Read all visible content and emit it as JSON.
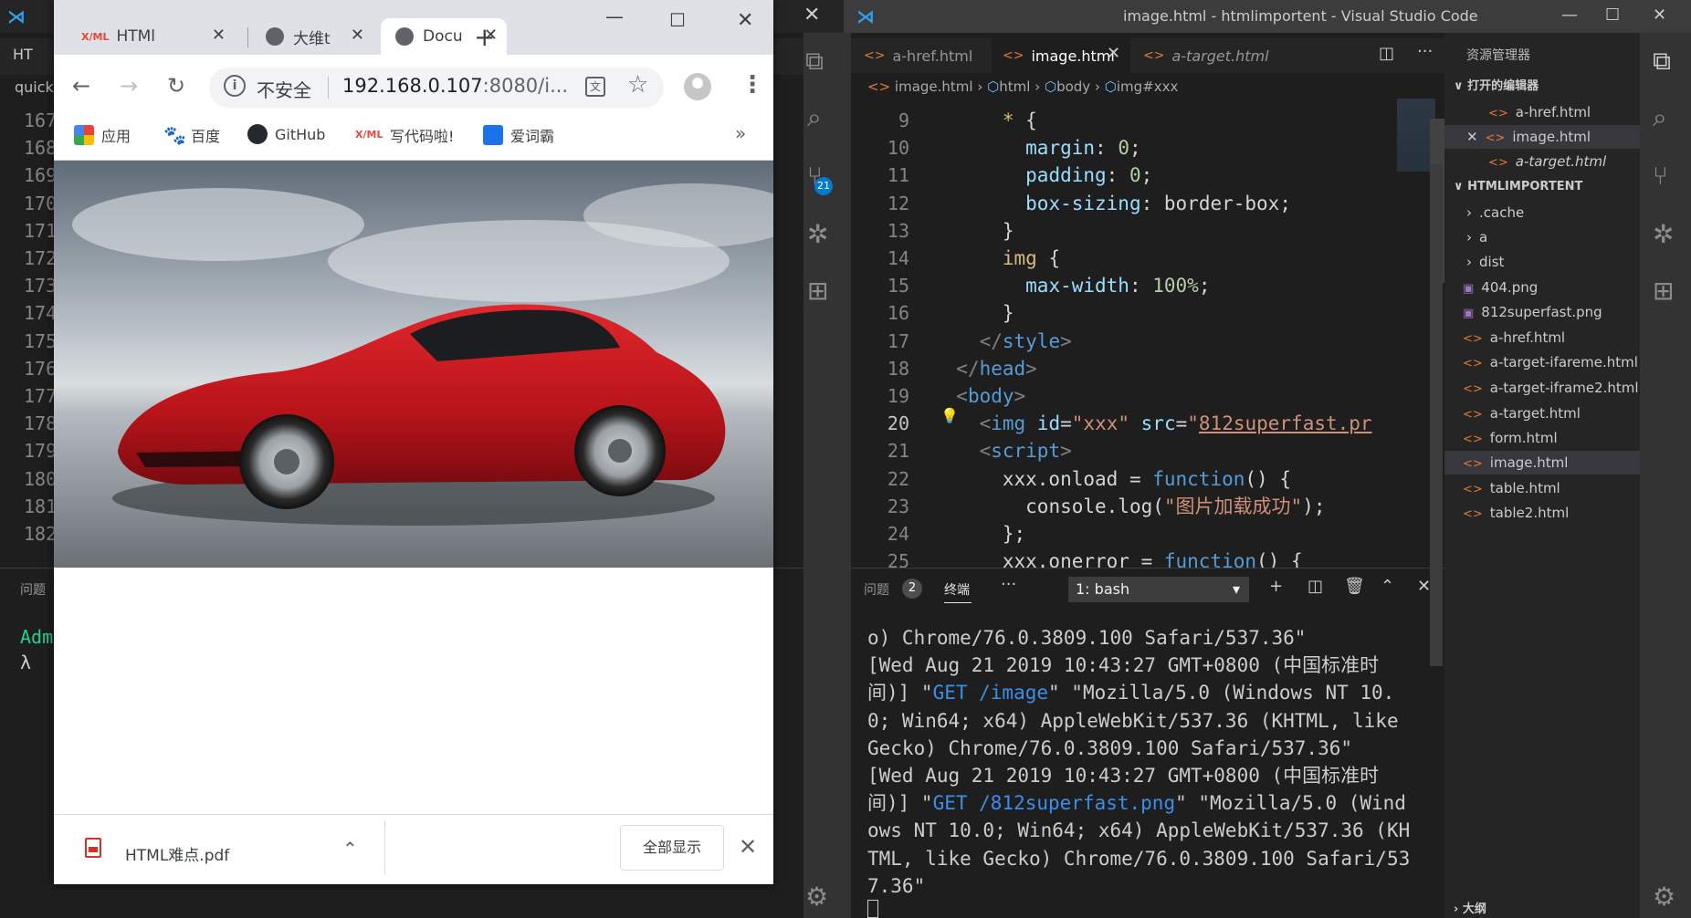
{
  "left_window": {
    "tab_label": "HT",
    "breadcrumb": "quicks",
    "line_numbers": [
      "167",
      "168",
      "169",
      "170",
      "171",
      "172",
      "173",
      "174",
      "175",
      "176",
      "177",
      "178",
      "179",
      "180",
      "181",
      "182"
    ],
    "panel_tab": "问题",
    "terminal_prompt": "Adm",
    "terminal_lambda": "λ"
  },
  "chrome": {
    "tabs": [
      {
        "title": "HTMl",
        "icon": "xml-icon"
      },
      {
        "title": "大维t",
        "icon": "globe-icon"
      },
      {
        "title": "Docu",
        "icon": "globe-icon",
        "active": true
      }
    ],
    "omnibox": {
      "security_text": "不安全",
      "host": "192.168.0.107",
      "port_path": ":8080/i..."
    },
    "bookmarks": [
      {
        "label": "应用",
        "icon": "apps-grid-icon"
      },
      {
        "label": "百度",
        "icon": "baidu-paw-icon"
      },
      {
        "label": "GitHub",
        "icon": "github-icon"
      },
      {
        "label": "写代码啦!",
        "icon": "xml-icon"
      },
      {
        "label": "爱词霸",
        "icon": "iciba-icon"
      }
    ],
    "bookmarks_more": "»",
    "download": {
      "filename": "HTML难点.pdf",
      "show_all": "全部显示"
    }
  },
  "vscode": {
    "window_title": "image.html - htmlimportent - Visual Studio Code",
    "tabs": [
      {
        "label": "a-href.html"
      },
      {
        "label": "image.html",
        "active": true
      },
      {
        "label": "a-target.html",
        "italic": true
      }
    ],
    "breadcrumb": [
      "image.html",
      "html",
      "body",
      "img#xxx"
    ],
    "line_numbers": [
      "9",
      "10",
      "11",
      "12",
      "13",
      "14",
      "15",
      "16",
      "17",
      "18",
      "19",
      "20",
      "21",
      "22",
      "23",
      "24",
      "25"
    ],
    "current_line": "20",
    "scm_badge": "21",
    "terminal": {
      "tab_problems": "问题",
      "problems_count": "2",
      "tab_terminal": "终端",
      "more": "···",
      "selected_shell": "1: bash",
      "lines": [
        {
          "text": "o) Chrome/76.0.3809.100 Safari/537.36\""
        },
        {
          "pre": "[Wed Aug 21 2019 10:43:27 GMT+0800 (中国标准时间)] \"",
          "blue": "GET /image",
          "post": "\" \"Mozilla/5.0 (Windows NT 10.0; Win64; x64) AppleWebKit/537.36 (KHTML, like Gecko) Chrome/76.0.3809.100 Safari/537.36\""
        },
        {
          "pre": "[Wed Aug 21 2019 10:43:27 GMT+0800 (中国标准时间)] \"",
          "blue": "GET /812superfast.png",
          "post": "\" \"Mozilla/5.0 (Windows NT 10.0; Win64; x64) AppleWebKit/537.36 (KHTML, like Gecko) Chrome/76.0.3809.100 Safari/537.36\""
        }
      ]
    },
    "explorer": {
      "title": "资源管理器",
      "open_editors_label": "打开的编辑器",
      "open_editors": [
        "a-href.html",
        "image.html",
        "a-target.html"
      ],
      "project_label": "HTMLIMPORTENT",
      "folders": [
        ".cache",
        "a",
        "dist"
      ],
      "files": [
        "404.png",
        "812superfast.png",
        "a-href.html",
        "a-target-ifareme.html",
        "a-target-iframe2.html",
        "a-target.html",
        "form.html",
        "image.html",
        "table.html",
        "table2.html"
      ],
      "outline_label": "大纲"
    },
    "code_tokens": {
      "star": "*",
      "margin": "margin",
      "zero": "0",
      "padding": "padding",
      "box_sizing": "box-sizing",
      "border_box": "border-box",
      "img": "img",
      "max_width": "max-width",
      "hundred": "100%",
      "style": "style",
      "head": "head",
      "body": "body",
      "id_attr": "id",
      "id_val": "\"xxx\"",
      "src_attr": "src",
      "src_val": "812superfast.pr",
      "script": "script",
      "xxx_onload": "xxx.onload",
      "function": "function",
      "console_log": "console.log",
      "log_str": "\"图片加载成功\"",
      "xxx_onerror": "xxx.onerror"
    }
  }
}
